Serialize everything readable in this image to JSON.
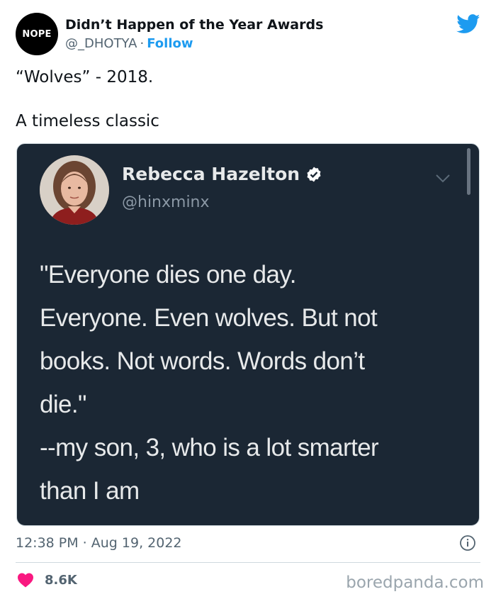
{
  "header": {
    "avatar_text": "NOPE",
    "account_name": "Didn’t Happen of the Year Awards",
    "handle": "@_DHOTYA",
    "separator": "·",
    "follow_label": "Follow"
  },
  "tweet": {
    "line1": "“Wolves” - 2018.",
    "line2": "A timeless classic"
  },
  "embedded": {
    "name": "Rebecca Hazelton",
    "handle": "@hinxminx",
    "quote_lines": [
      "\"Everyone dies one day.",
      "Everyone. Even wolves. But not",
      "books. Not words. Words don’t",
      "die.\"",
      "--my son, 3, who is a lot smarter",
      "than I am"
    ]
  },
  "footer": {
    "timestamp": "12:38 PM · Aug 19, 2022",
    "likes": "8.6K",
    "watermark": "boredpanda.com"
  },
  "colors": {
    "twitter_blue": "#1d9bf0",
    "heart_red": "#f91880",
    "embedded_bg": "#1b2734"
  },
  "icons": [
    "twitter-bird-icon",
    "verified-badge-icon",
    "chevron-down-icon",
    "info-icon",
    "heart-icon"
  ]
}
